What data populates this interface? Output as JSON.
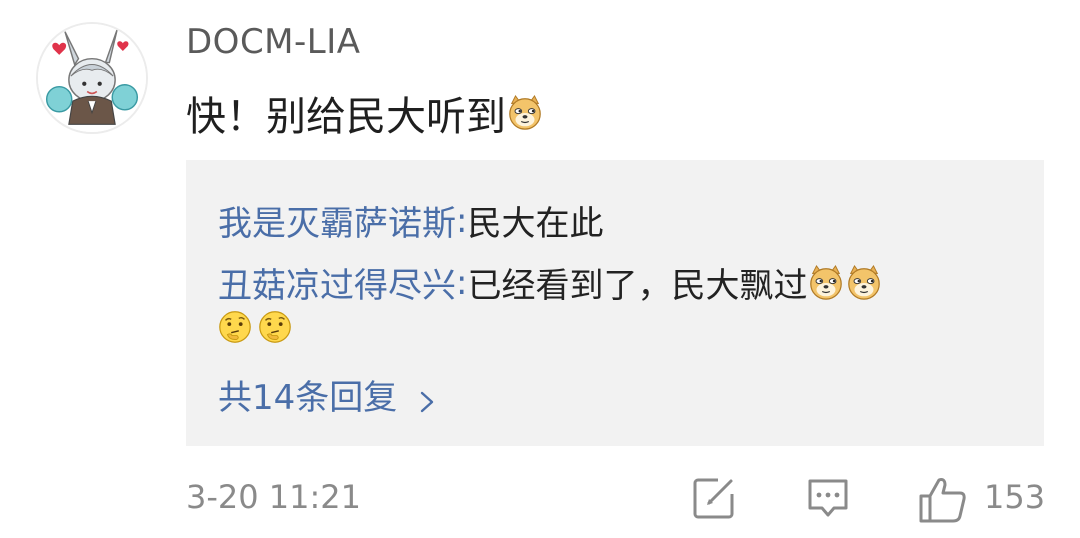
{
  "comment": {
    "username": "DOCM-LIA",
    "text": "快！别给民大听到",
    "timestamp": "3-20 11:21",
    "like_count": "153"
  },
  "replies": [
    {
      "author": "我是灭霸萨诺斯",
      "separator": ": ",
      "text": "民大在此"
    },
    {
      "author": "丑菇凉过得尽兴",
      "separator": ": ",
      "text": "已经看到了，民大飘过"
    }
  ],
  "reply_summary": {
    "label": "共14条回复"
  },
  "icons": {
    "avatar": "anime-bunny-avatar",
    "doge": "doge-emoji-icon",
    "thinking": "thinking-emoji-icon",
    "edit": "edit-icon",
    "comment": "comment-icon",
    "like": "thumbs-up-icon",
    "chevron": "chevron-right-icon"
  },
  "colors": {
    "link": "#4a6ea8",
    "reply_bg": "#f2f2f2",
    "meta": "#8a8a8a"
  }
}
